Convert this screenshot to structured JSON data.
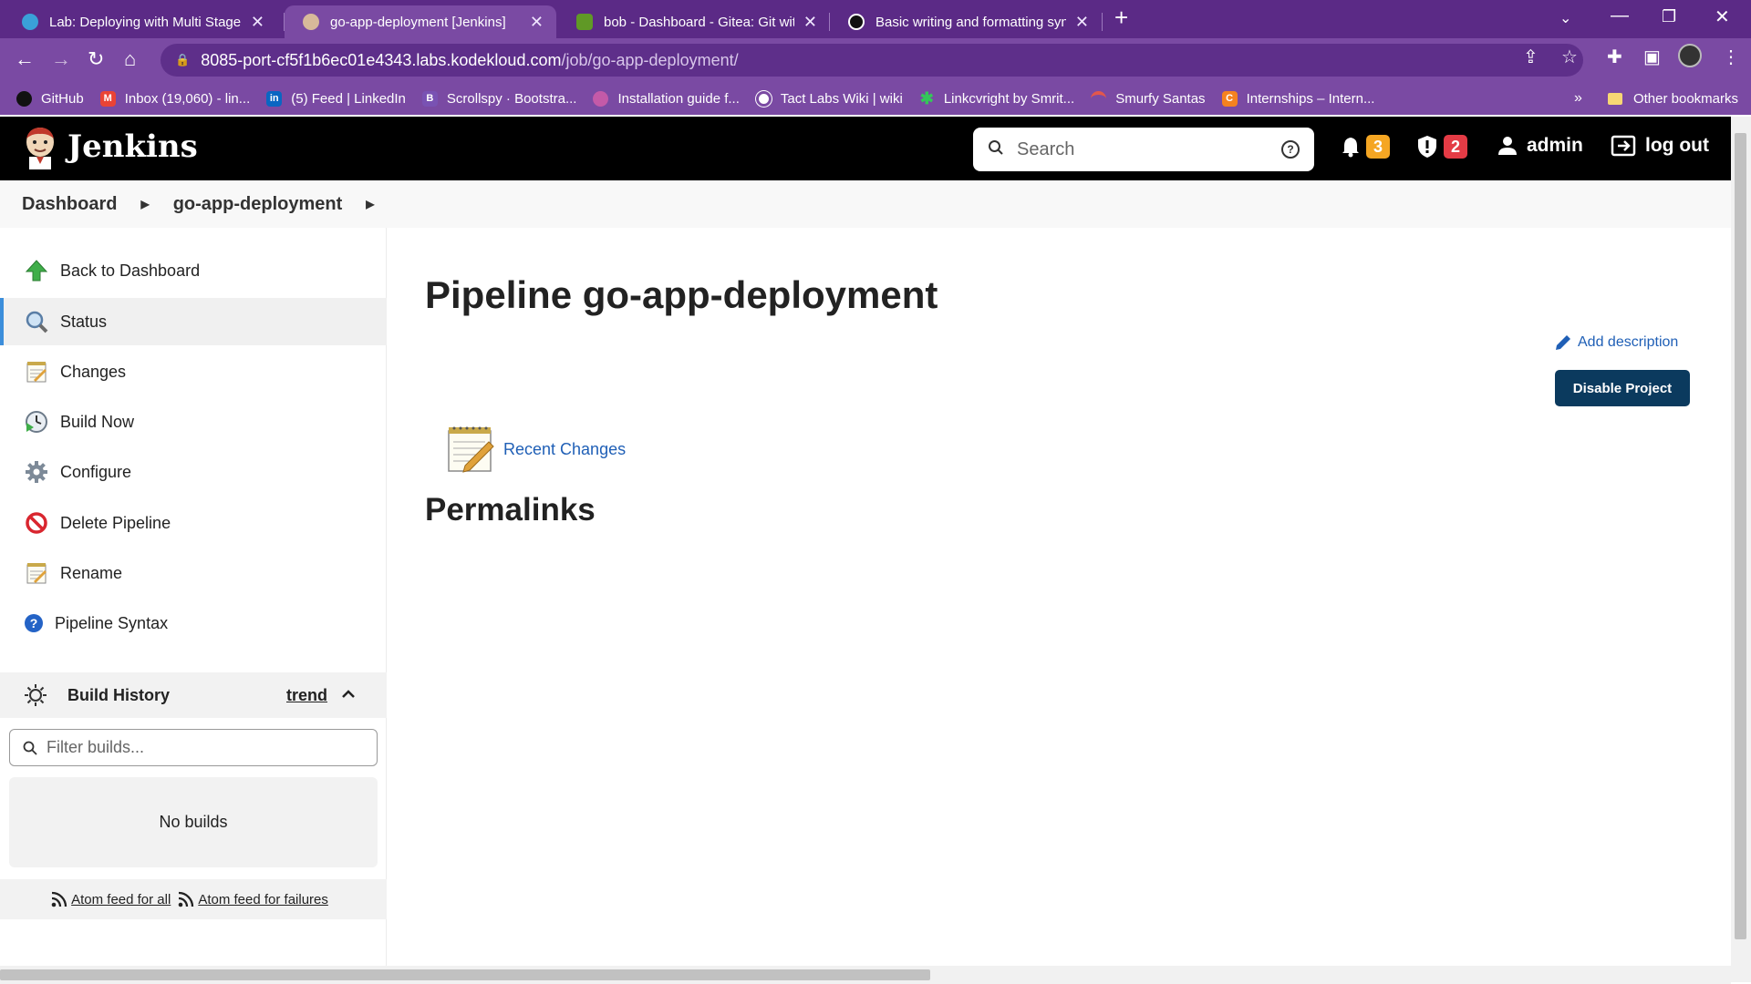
{
  "browser": {
    "tabs": [
      {
        "title": "Lab: Deploying with Multi Stage P",
        "favicon_color": "#3aa0d8",
        "active": false
      },
      {
        "title": "go-app-deployment [Jenkins]",
        "favicon_color": "#d8b99a",
        "active": true
      },
      {
        "title": "bob - Dashboard - Gitea: Git with",
        "favicon_color": "#609926",
        "active": false
      },
      {
        "title": "Basic writing and formatting synt",
        "favicon_color": "#111111",
        "active": false
      }
    ],
    "url_host": "8085-port-cf5f1b6ec01e4343.labs.kodekloud.com",
    "url_path": "/job/go-app-deployment/",
    "bookmarks": [
      {
        "label": "GitHub",
        "icon_color": "#111111",
        "glyph": ""
      },
      {
        "label": "Inbox (19,060) - lin...",
        "icon_color": "#ea4335",
        "glyph": "M"
      },
      {
        "label": "(5) Feed | LinkedIn",
        "icon_color": "#0a66c2",
        "glyph": "in"
      },
      {
        "label": "Scrollspy · Bootstra...",
        "icon_color": "#7952b3",
        "glyph": "B"
      },
      {
        "label": "Installation guide f...",
        "icon_color": "#c45aa8",
        "glyph": ""
      },
      {
        "label": "Tact Labs Wiki | wiki",
        "icon_color": "#ffffff",
        "glyph": ""
      },
      {
        "label": "Linkcvright by Smrit...",
        "icon_color": "#34c759",
        "glyph": "✱"
      },
      {
        "label": "Smurfy Santas",
        "icon_color": "#e2574c",
        "glyph": ""
      },
      {
        "label": "Internships – Intern...",
        "icon_color": "#f58220",
        "glyph": "C"
      }
    ],
    "other_bookmarks": "Other bookmarks"
  },
  "header": {
    "app_name": "Jenkins",
    "search_placeholder": "Search",
    "notifications_count": "3",
    "security_count": "2",
    "user": "admin",
    "logout": "log out"
  },
  "breadcrumb": [
    "Dashboard",
    "go-app-deployment"
  ],
  "sidebar": {
    "items": [
      {
        "label": "Back to Dashboard",
        "icon": "up-arrow-icon"
      },
      {
        "label": "Status",
        "icon": "magnifier-icon"
      },
      {
        "label": "Changes",
        "icon": "notepad-icon"
      },
      {
        "label": "Build Now",
        "icon": "clock-play-icon"
      },
      {
        "label": "Configure",
        "icon": "gear-icon"
      },
      {
        "label": "Delete Pipeline",
        "icon": "no-entry-icon"
      },
      {
        "label": "Rename",
        "icon": "notepad-icon"
      },
      {
        "label": "Pipeline Syntax",
        "icon": "help-icon"
      }
    ],
    "build_history": {
      "title": "Build History",
      "trend": "trend",
      "filter_placeholder": "Filter builds...",
      "empty_text": "No builds",
      "feed_all": "Atom feed for all",
      "feed_failures": "Atom feed for failures"
    }
  },
  "main": {
    "title": "Pipeline go-app-deployment",
    "add_description": "Add description",
    "disable_button": "Disable Project",
    "recent_changes": "Recent Changes",
    "permalinks": "Permalinks"
  }
}
